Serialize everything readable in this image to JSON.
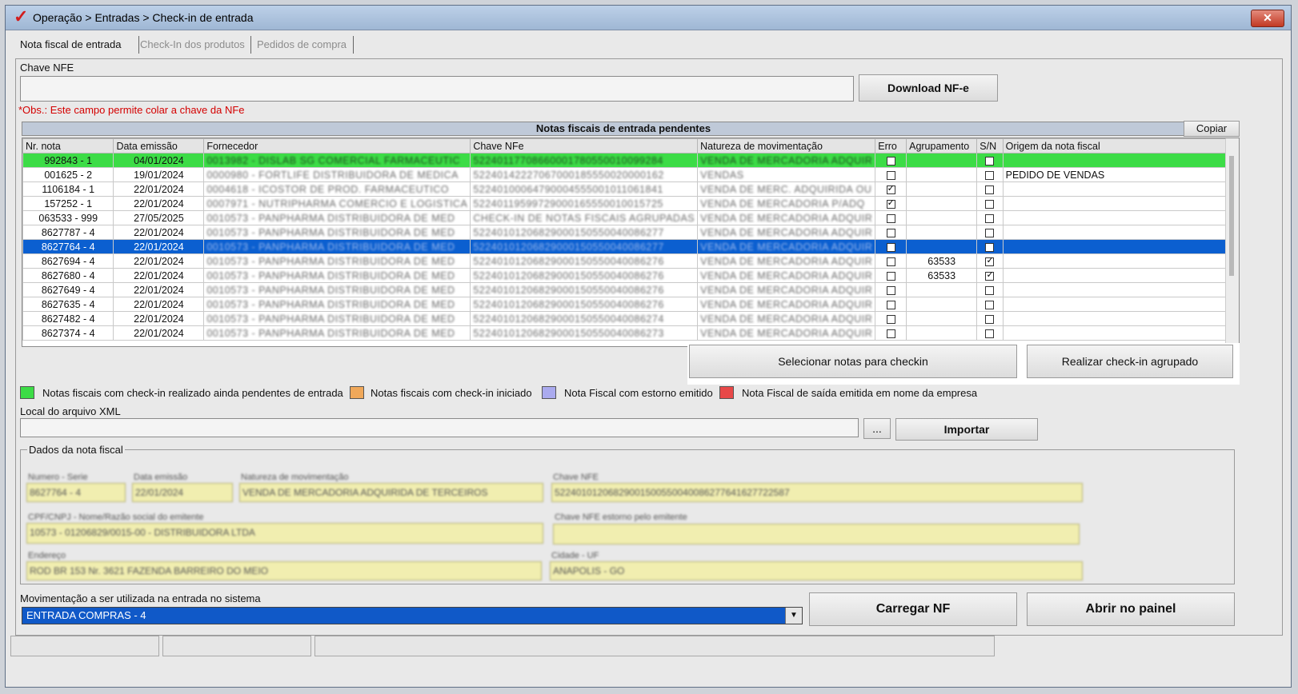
{
  "window": {
    "title": "Operação > Entradas > Check-in de entrada",
    "close_label": "✕"
  },
  "tabs": [
    "Nota fiscal de entrada",
    "Check-In dos produtos",
    "Pedidos de compra"
  ],
  "chave_section": {
    "label": "Chave NFE",
    "value": "",
    "download_label": "Download NF-e",
    "note": "*Obs.: Este campo permite colar a chave da NFe"
  },
  "grid": {
    "title": "Notas fiscais de entrada pendentes",
    "copy_label": "Copiar",
    "columns": [
      "Nr. nota",
      "Data emissão",
      "Fornecedor",
      "Chave NFe",
      "Natureza de movimentação",
      "Erro",
      "Agrupamento",
      "S/N",
      "Origem da nota fiscal"
    ],
    "rows": [
      {
        "nr": "992843 - 1",
        "data": "04/01/2024",
        "fornecedor": "0013982 - DISLAB SG COMERCIAL FARMACEUTIC",
        "chave": "52240117708660001780550010099284",
        "natureza": "VENDA DE MERCADORIA ADQUIR",
        "erro": false,
        "agrup": "",
        "sn": false,
        "origem": "",
        "style": "green"
      },
      {
        "nr": "001625 - 2",
        "data": "19/01/2024",
        "fornecedor": "0000980 - FORTLIFE DISTRIBUIDORA DE MEDICA",
        "chave": "52240142227067000185550020000162",
        "natureza": "VENDAS",
        "erro": false,
        "agrup": "",
        "sn": false,
        "origem": "PEDIDO DE VENDAS",
        "style": ""
      },
      {
        "nr": "1106184 - 1",
        "data": "22/01/2024",
        "fornecedor": "0004618 - ICOSTOR DE PROD. FARMACEUTICO",
        "chave": "52240100064790004555001011061841",
        "natureza": "VENDA DE MERC. ADQUIRIDA OU",
        "erro": true,
        "agrup": "",
        "sn": false,
        "origem": "",
        "style": ""
      },
      {
        "nr": "157252 - 1",
        "data": "22/01/2024",
        "fornecedor": "0007971 - NUTRIPHARMA COMERCIO E LOGISTICA",
        "chave": "52240119599729000165550010015725",
        "natureza": "VENDA DE MERCADORIA P/ADQ",
        "erro": true,
        "agrup": "",
        "sn": false,
        "origem": "",
        "style": ""
      },
      {
        "nr": "063533 - 999",
        "data": "27/05/2025",
        "fornecedor": "0010573 - PANPHARMA DISTRIBUIDORA DE MED",
        "chave": "CHECK-IN DE NOTAS FISCAIS AGRUPADAS",
        "natureza": "VENDA DE MERCADORIA ADQUIR",
        "erro": false,
        "agrup": "",
        "sn": false,
        "origem": "",
        "style": ""
      },
      {
        "nr": "8627787 - 4",
        "data": "22/01/2024",
        "fornecedor": "0010573 - PANPHARMA DISTRIBUIDORA DE MED",
        "chave": "52240101206829000150550040086277",
        "natureza": "VENDA DE MERCADORIA ADQUIR",
        "erro": false,
        "agrup": "",
        "sn": false,
        "origem": "",
        "style": ""
      },
      {
        "nr": "8627764 - 4",
        "data": "22/01/2024",
        "fornecedor": "0010573 - PANPHARMA DISTRIBUIDORA DE MED",
        "chave": "52240101206829000150550040086277",
        "natureza": "VENDA DE MERCADORIA ADQUIR",
        "erro": false,
        "agrup": "",
        "sn": false,
        "origem": "",
        "style": "sel"
      },
      {
        "nr": "8627694 - 4",
        "data": "22/01/2024",
        "fornecedor": "0010573 - PANPHARMA DISTRIBUIDORA DE MED",
        "chave": "52240101206829000150550040086276",
        "natureza": "VENDA DE MERCADORIA ADQUIR",
        "erro": false,
        "agrup": "63533",
        "sn": true,
        "origem": "",
        "style": ""
      },
      {
        "nr": "8627680 - 4",
        "data": "22/01/2024",
        "fornecedor": "0010573 - PANPHARMA DISTRIBUIDORA DE MED",
        "chave": "52240101206829000150550040086276",
        "natureza": "VENDA DE MERCADORIA ADQUIR",
        "erro": false,
        "agrup": "63533",
        "sn": true,
        "origem": "",
        "style": ""
      },
      {
        "nr": "8627649 - 4",
        "data": "22/01/2024",
        "fornecedor": "0010573 - PANPHARMA DISTRIBUIDORA DE MED",
        "chave": "52240101206829000150550040086276",
        "natureza": "VENDA DE MERCADORIA ADQUIR",
        "erro": false,
        "agrup": "",
        "sn": false,
        "origem": "",
        "style": ""
      },
      {
        "nr": "8627635 - 4",
        "data": "22/01/2024",
        "fornecedor": "0010573 - PANPHARMA DISTRIBUIDORA DE MED",
        "chave": "52240101206829000150550040086276",
        "natureza": "VENDA DE MERCADORIA ADQUIR",
        "erro": false,
        "agrup": "",
        "sn": false,
        "origem": "",
        "style": ""
      },
      {
        "nr": "8627482 - 4",
        "data": "22/01/2024",
        "fornecedor": "0010573 - PANPHARMA DISTRIBUIDORA DE MED",
        "chave": "52240101206829000150550040086274",
        "natureza": "VENDA DE MERCADORIA ADQUIR",
        "erro": false,
        "agrup": "",
        "sn": false,
        "origem": "",
        "style": ""
      },
      {
        "nr": "8627374 - 4",
        "data": "22/01/2024",
        "fornecedor": "0010573 - PANPHARMA DISTRIBUIDORA DE MED",
        "chave": "52240101206829000150550040086273",
        "natureza": "VENDA DE MERCADORIA ADQUIR",
        "erro": false,
        "agrup": "",
        "sn": false,
        "origem": "",
        "style": ""
      }
    ]
  },
  "actions": {
    "select_label": "Selecionar notas para checkin",
    "group_label": "Realizar check-in agrupado"
  },
  "legend": [
    {
      "label": "Notas fiscais com check-in realizado ainda pendentes de entrada",
      "color": "#3cdc46"
    },
    {
      "label": "Notas fiscais com check-in iniciado",
      "color": "#f0a85a"
    },
    {
      "label": "Nota Fiscal com estorno emitido",
      "color": "#aaaaee"
    },
    {
      "label": "Nota Fiscal de saída emitida em nome da empresa",
      "color": "#e84848"
    }
  ],
  "xml": {
    "label": "Local do arquivo XML",
    "value": "",
    "browse_label": "...",
    "import_label": "Importar"
  },
  "nf_details": {
    "legend": "Dados da nota fiscal",
    "numero_label": "Numero - Serie",
    "numero_value": "8627764 - 4",
    "data_label": "Data emissão",
    "data_value": "22/01/2024",
    "natureza_label": "Natureza de movimentação",
    "natureza_value": "VENDA DE MERCADORIA ADQUIRIDA DE TERCEIROS",
    "chave_label": "Chave NFE",
    "chave_value": "52240101206829001500550040086277641627722587",
    "cpf_label": "CPF/CNPJ - Nome/Razão social do emitente",
    "cpf_value": "10573 - 01206829/0015-00 - DISTRIBUIDORA LTDA",
    "estorno_label": "Chave NFE estorno pelo emitente",
    "estorno_value": "",
    "endereco_label": "Endereço",
    "endereco_value": "ROD BR 153 Nr. 3621 FAZENDA BARREIRO DO MEIO",
    "cidade_label": "Cidade - UF",
    "cidade_value": "ANAPOLIS - GO"
  },
  "movimentacao": {
    "label": "Movimentação a ser utilizada na entrada no sistema",
    "selected": "ENTRADA COMPRAS - 4",
    "carregar_label": "Carregar NF",
    "abrir_label": "Abrir no painel"
  }
}
